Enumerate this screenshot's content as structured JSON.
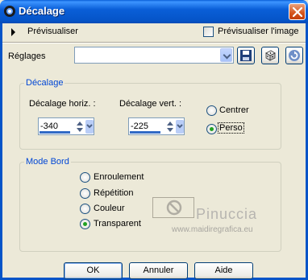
{
  "window": {
    "title": "Décalage",
    "close_label": "close"
  },
  "preview": {
    "expand_label": "Prévisualiser",
    "checkbox_label": "Prévisualiser l'image",
    "checkbox_checked": false
  },
  "settings": {
    "label": "Réglages",
    "combo_value": ""
  },
  "offset_group": {
    "title": "Décalage",
    "horiz_label": "Décalage horiz. :",
    "horiz_value": "-340",
    "vert_label": "Décalage vert. :",
    "vert_value": "-225",
    "options": [
      {
        "label": "Centrer",
        "selected": false
      },
      {
        "label": "Perso",
        "selected": true
      }
    ]
  },
  "edge_group": {
    "title": "Mode Bord",
    "options": [
      {
        "label": "Enroulement",
        "selected": false
      },
      {
        "label": "Répétition",
        "selected": false
      },
      {
        "label": "Couleur",
        "selected": false
      },
      {
        "label": "Transparent",
        "selected": true
      }
    ]
  },
  "watermark": {
    "name": "Pinuccia",
    "url": "www.maidiregrafica.eu"
  },
  "buttons": {
    "ok": "OK",
    "cancel": "Annuler",
    "help": "Aide"
  },
  "colors": {
    "titlebar": "#0a5fd8",
    "accent_text": "#0046d5",
    "radio_on": "#21a121",
    "face": "#ece9d8"
  },
  "icons": [
    "title-app-icon",
    "close-icon",
    "expand-triangle-icon",
    "save-icon",
    "dice-icon",
    "reset-icon",
    "no-color-icon"
  ]
}
